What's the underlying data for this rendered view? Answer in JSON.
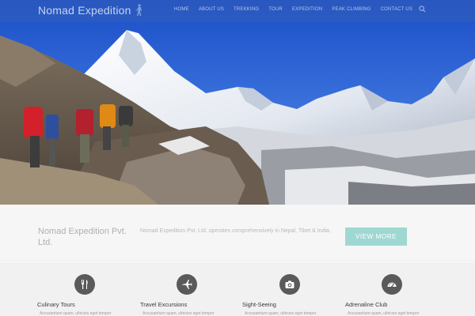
{
  "brand": {
    "name": "Nomad Expedition"
  },
  "nav": {
    "items": [
      "HOME",
      "ABOUT US",
      "TREKKING",
      "TOUR",
      "EXPEDITION",
      "PEAK CLIMBING",
      "CONTACT US"
    ]
  },
  "hero": {
    "image": "trekkers-himalaya-mountains-photo"
  },
  "intro": {
    "title": "Nomad Expedition Pvt. Ltd.",
    "text": "Nomad Expedition Pvt. Ltd. operates comprehensively in Nepal, Tibet & India.",
    "cta_label": "VIEW MORE"
  },
  "services": [
    {
      "title": "Culinary Tours",
      "icon": "cutlery-icon",
      "text": "Accusantium quam, ultricies eget tempor"
    },
    {
      "title": "Travel Excursions",
      "icon": "airplane-icon",
      "text": "Accusantium quam, ultricies eget tempor"
    },
    {
      "title": "Sight-Seeing",
      "icon": "camera-icon",
      "text": "Accusantium quam, ultricies eget tempor"
    },
    {
      "title": "Adrenaline Club",
      "icon": "speedometer-icon",
      "text": "Accusantium quam, ultricies eget tempor"
    }
  ],
  "colors": {
    "navbar": "#345fb9",
    "cta": "#9fd8d2",
    "service_icon_bg": "#5a5a5a",
    "intro_bg": "#f6f6f6"
  }
}
